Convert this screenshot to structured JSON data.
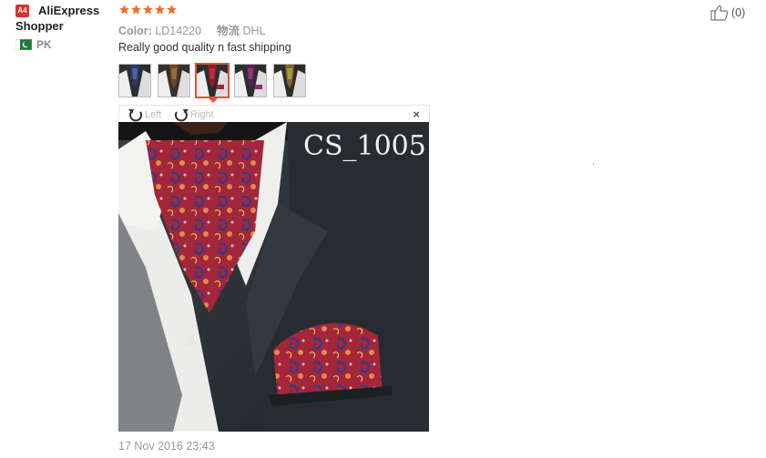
{
  "reviewer": {
    "badge": "A4",
    "name": "AliExpress Shopper",
    "country_code": "PK"
  },
  "rating": {
    "stars": 5,
    "max": 5,
    "color": "#f26c23"
  },
  "properties": [
    {
      "key": "Color:",
      "value": "LD14220"
    },
    {
      "key": "物流",
      "value": "DHL"
    }
  ],
  "review_text": "Really good quality n fast shipping",
  "thumbnails": {
    "count": 5,
    "active_index": 2
  },
  "viewer": {
    "rotate_left_label": "Left",
    "rotate_right_label": "Right",
    "close_label": "×",
    "watermark": "CS_1005"
  },
  "review_date": "17 Nov 2016 23:43",
  "helpful": {
    "count_label": "(0)"
  },
  "colors": {
    "badge_red": "#d8352a",
    "active_border": "#e4503a",
    "flag_green": "#1f7a3a"
  }
}
